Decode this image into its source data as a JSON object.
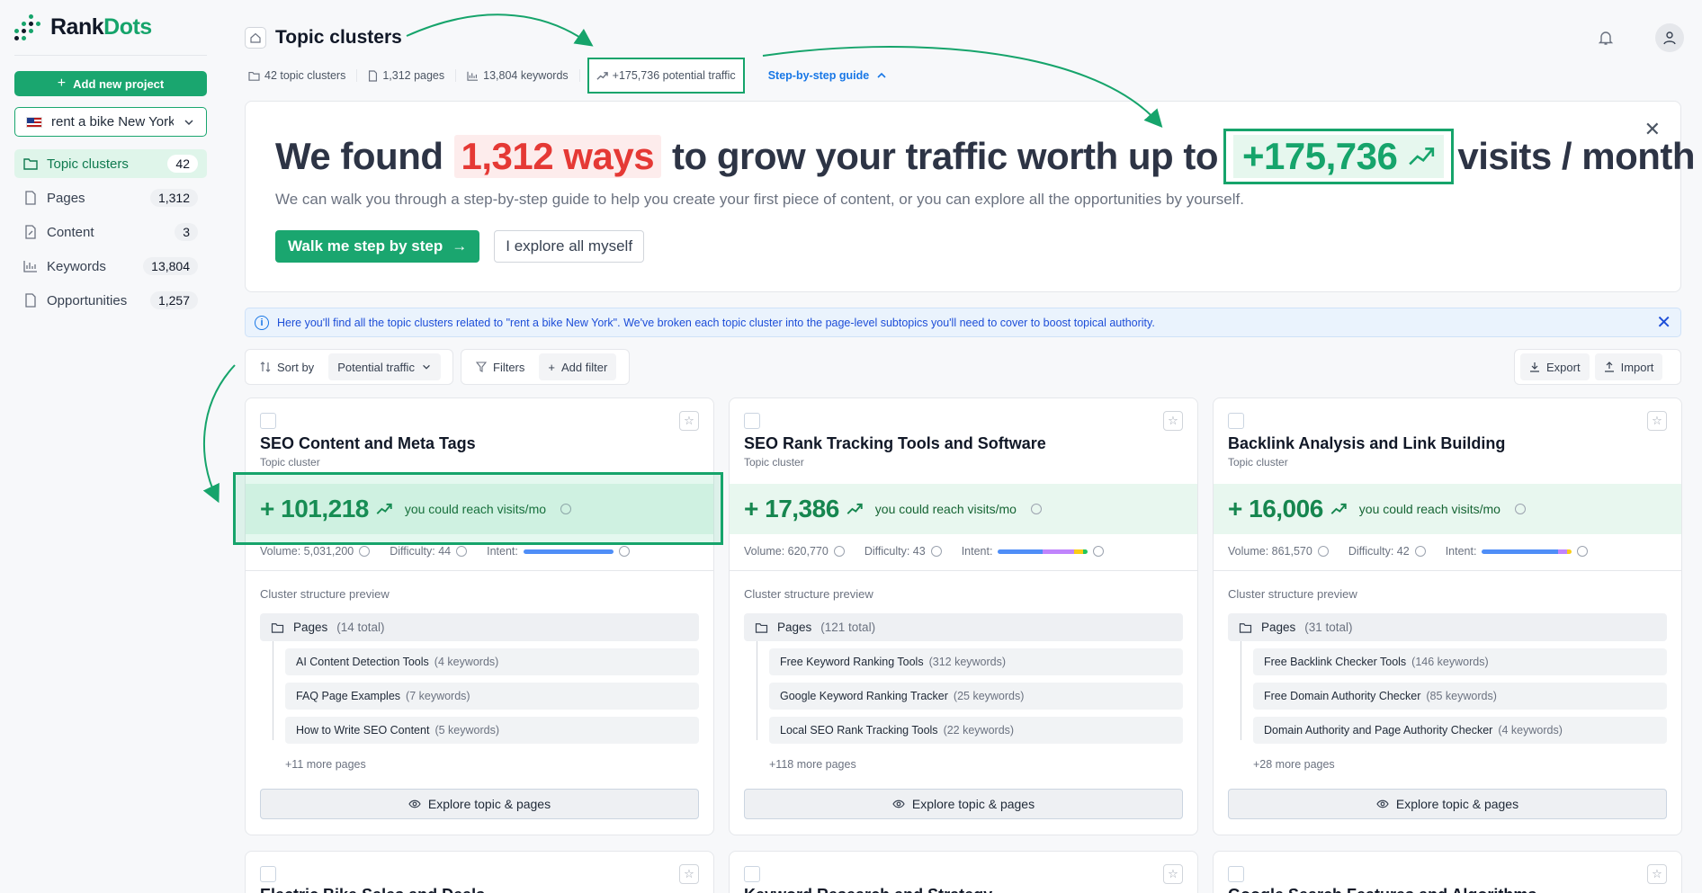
{
  "brand": {
    "name_part1": "Rank",
    "name_part2": "Dots",
    "accent": "#16a46b"
  },
  "sidebar": {
    "add_project_label": "Add new project",
    "project": {
      "flag": "us-flag",
      "name": "rent a bike New York"
    },
    "items": [
      {
        "label": "Topic clusters",
        "count": "42",
        "icon": "folder-icon",
        "active": true
      },
      {
        "label": "Pages",
        "count": "1,312",
        "icon": "page-icon"
      },
      {
        "label": "Content",
        "count": "3",
        "icon": "edit-icon"
      },
      {
        "label": "Keywords",
        "count": "13,804",
        "icon": "chart-icon"
      },
      {
        "label": "Opportunities",
        "count": "1,257",
        "icon": "page-icon"
      }
    ]
  },
  "header": {
    "title": "Topic clusters",
    "stats": {
      "clusters": "42 topic clusters",
      "pages": "1,312 pages",
      "keywords": "13,804 keywords",
      "traffic": "+175,736 potential traffic",
      "guide": "Step-by-step guide"
    }
  },
  "hero": {
    "prefix": "We found",
    "ways": "1,312 ways",
    "middle": "to grow your traffic worth up to",
    "traffic": "+175,736",
    "suffix": "visits / month",
    "description": "We can walk you through a step-by-step guide to help you create your first piece of content, or you can explore all the opportunities by yourself.",
    "primary_btn": "Walk me step by step",
    "secondary_btn": "I explore all myself"
  },
  "info": {
    "text": "Here you'll find all the topic clusters related to \"rent a bike New York\". We've broken each topic cluster into the page-level subtopics you'll need to cover to boost topical authority."
  },
  "toolbar": {
    "sort_label": "Sort by",
    "sort_value": "Potential traffic",
    "filters_label": "Filters",
    "add_filter_label": "Add filter",
    "export_label": "Export",
    "import_label": "Import"
  },
  "cards": [
    {
      "title": "SEO Content and Meta Tags",
      "subtitle": "Topic cluster",
      "reach": "+ 101,218",
      "reach_text": "you could reach visits/mo",
      "volume": "Volume: 5,031,200",
      "difficulty": "Difficulty: 44",
      "intent_label": "Intent:",
      "intent": [
        {
          "share": 1.0,
          "color": "#4f8ef7"
        }
      ],
      "preview_label": "Cluster structure preview",
      "pages_label": "Pages",
      "pages_total": "(14 total)",
      "pages": [
        {
          "name": "AI Content Detection Tools",
          "kw": "(4 keywords)"
        },
        {
          "name": "FAQ Page Examples",
          "kw": "(7 keywords)"
        },
        {
          "name": "How to Write SEO Content",
          "kw": "(5 keywords)"
        }
      ],
      "more": "+11 more pages",
      "explore": "Explore topic & pages"
    },
    {
      "title": "SEO Rank Tracking Tools and Software",
      "subtitle": "Topic cluster",
      "reach": "+ 17,386",
      "reach_text": "you could reach visits/mo",
      "volume": "Volume: 620,770",
      "difficulty": "Difficulty: 43",
      "intent_label": "Intent:",
      "intent": [
        {
          "share": 0.5,
          "color": "#4f8ef7"
        },
        {
          "share": 0.35,
          "color": "#c084fc"
        },
        {
          "share": 0.1,
          "color": "#facc15"
        },
        {
          "share": 0.05,
          "color": "#22c55e"
        }
      ],
      "preview_label": "Cluster structure preview",
      "pages_label": "Pages",
      "pages_total": "(121 total)",
      "pages": [
        {
          "name": "Free Keyword Ranking Tools",
          "kw": "(312 keywords)"
        },
        {
          "name": "Google Keyword Ranking Tracker",
          "kw": "(25 keywords)"
        },
        {
          "name": "Local SEO Rank Tracking Tools",
          "kw": "(22 keywords)"
        }
      ],
      "more": "+118 more pages",
      "explore": "Explore topic & pages"
    },
    {
      "title": "Backlink Analysis and Link Building",
      "subtitle": "Topic cluster",
      "reach": "+ 16,006",
      "reach_text": "you could reach visits/mo",
      "volume": "Volume: 861,570",
      "difficulty": "Difficulty: 42",
      "intent_label": "Intent:",
      "intent": [
        {
          "share": 0.85,
          "color": "#4f8ef7"
        },
        {
          "share": 0.1,
          "color": "#c084fc"
        },
        {
          "share": 0.05,
          "color": "#facc15"
        }
      ],
      "preview_label": "Cluster structure preview",
      "pages_label": "Pages",
      "pages_total": "(31 total)",
      "pages": [
        {
          "name": "Free Backlink Checker Tools",
          "kw": "(146 keywords)"
        },
        {
          "name": "Free Domain Authority Checker",
          "kw": "(85 keywords)"
        },
        {
          "name": "Domain Authority and Page Authority Checker",
          "kw": "(4 keywords)"
        }
      ],
      "more": "+28 more pages",
      "explore": "Explore topic & pages"
    }
  ],
  "next_cards": [
    {
      "title": "Electric Bike Sales and Deals"
    },
    {
      "title": "Keyword Research and Strategy"
    },
    {
      "title": "Google Search Features and Algorithms"
    }
  ]
}
